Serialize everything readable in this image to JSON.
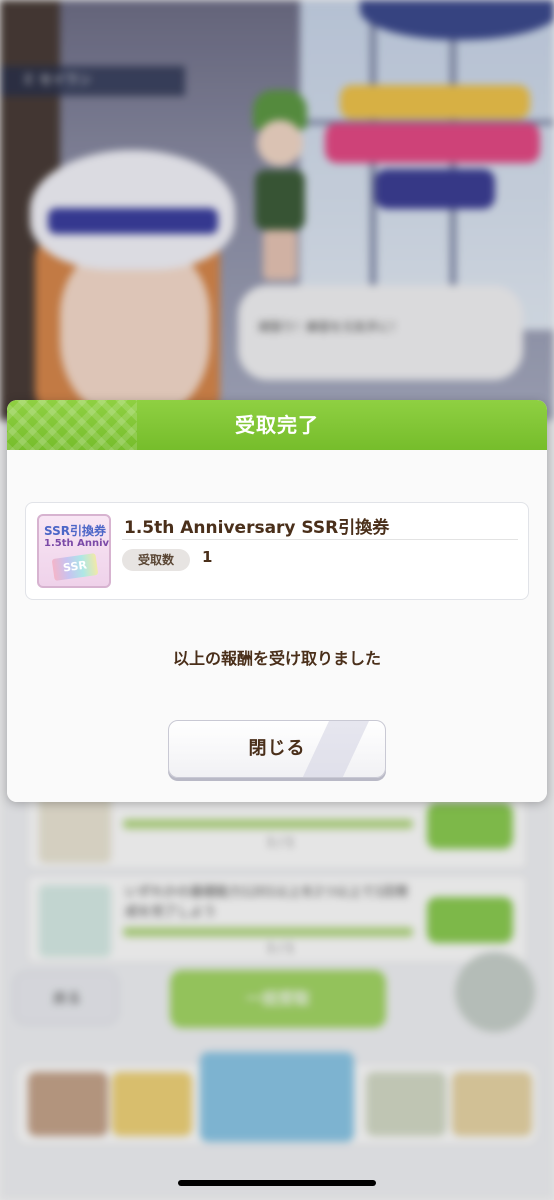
{
  "background": {
    "character_name": "ミ セイウン",
    "speech_text": "頑張り！練習を元気手に！",
    "missions": [
      {
        "text": "",
        "progress": "1 / 1"
      },
      {
        "text": "いずれかの基礎能力1201以上を2つ以上で1回育成を完了しよう",
        "progress": "1 / 1"
      }
    ],
    "back_label": "戻る",
    "collect_all_label": "一括受取"
  },
  "dialog": {
    "title": "受取完了",
    "item": {
      "name": "1.5th Anniversary SSR引換券",
      "icon_line1": "SSR引換券",
      "icon_line2": "1.5th Anniv.",
      "icon_ticket": "SSR",
      "quantity_label": "受取数",
      "quantity_value": "1"
    },
    "message": "以上の報酬を受け取りました",
    "close_label": "閉じる"
  },
  "colors": {
    "header_green": "#7fc536",
    "text_brown": "#4a2f1a"
  }
}
